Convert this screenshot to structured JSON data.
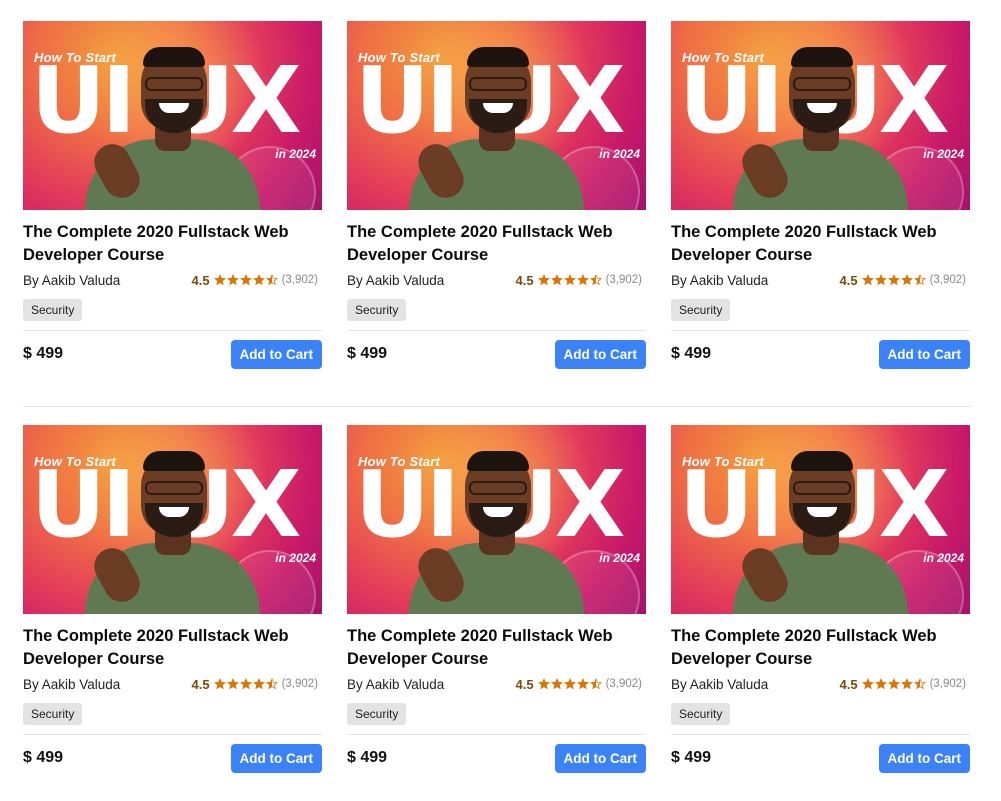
{
  "thumbnail": {
    "kicker": "How To Start",
    "headline": "UI UX",
    "year_label": "in 2024"
  },
  "colors": {
    "accent_button": "#3b82f6",
    "star": "#d97706",
    "badge_bg": "#e3e3e3"
  },
  "courses": [
    {
      "title": "The Complete 2020 Fullstack Web Developer Course",
      "author": "By Aakib Valuda",
      "rating": "4.5",
      "rating_count": "(3,902)",
      "stars": 4.5,
      "tag": "Security",
      "price": "$ 499",
      "cta": "Add to Cart"
    },
    {
      "title": "The Complete 2020 Fullstack Web Developer Course",
      "author": "By Aakib Valuda",
      "rating": "4.5",
      "rating_count": "(3,902)",
      "stars": 4.5,
      "tag": "Security",
      "price": "$ 499",
      "cta": "Add to Cart"
    },
    {
      "title": "The Complete 2020 Fullstack Web Developer Course",
      "author": "By Aakib Valuda",
      "rating": "4.5",
      "rating_count": "(3,902)",
      "stars": 4.5,
      "tag": "Security",
      "price": "$ 499",
      "cta": "Add to Cart"
    },
    {
      "title": "The Complete 2020 Fullstack Web Developer Course",
      "author": "By Aakib Valuda",
      "rating": "4.5",
      "rating_count": "(3,902)",
      "stars": 4.5,
      "tag": "Security",
      "price": "$ 499",
      "cta": "Add to Cart"
    },
    {
      "title": "The Complete 2020 Fullstack Web Developer Course",
      "author": "By Aakib Valuda",
      "rating": "4.5",
      "rating_count": "(3,902)",
      "stars": 4.5,
      "tag": "Security",
      "price": "$ 499",
      "cta": "Add to Cart"
    },
    {
      "title": "The Complete 2020 Fullstack Web Developer Course",
      "author": "By Aakib Valuda",
      "rating": "4.5",
      "rating_count": "(3,902)",
      "stars": 4.5,
      "tag": "Security",
      "price": "$ 499",
      "cta": "Add to Cart"
    }
  ]
}
